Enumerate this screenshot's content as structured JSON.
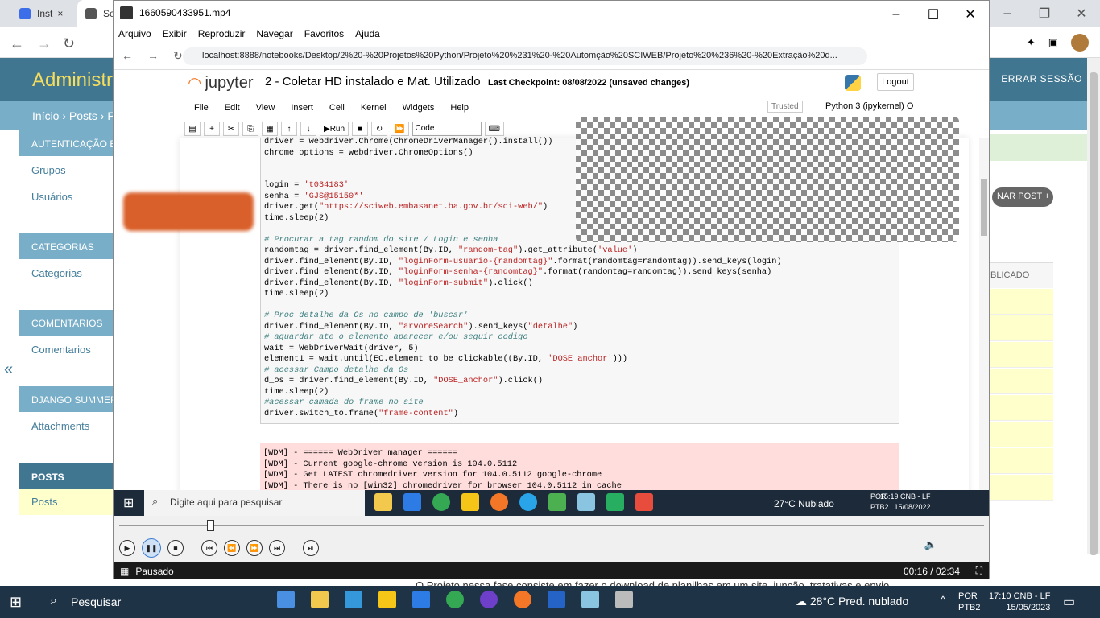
{
  "browser": {
    "tabs": [
      {
        "label": "Inst"
      },
      {
        "label": "Se"
      }
    ],
    "admin_title": "Administra",
    "logout": "ERRAR SESSÃO",
    "breadcrumb": "Início › Posts › P"
  },
  "sidebar": {
    "modules": [
      {
        "header": "AUTENTICAÇÃO E",
        "items": [
          "Grupos",
          "Usuários"
        ]
      },
      {
        "header": "CATEGORIAS",
        "items": [
          "Categorias"
        ]
      },
      {
        "header": "COMENTARIOS",
        "items": [
          "Comentarios"
        ]
      },
      {
        "header": "DJANGO SUMMER",
        "items": [
          "Attachments"
        ]
      },
      {
        "header": "POSTS",
        "items": [
          "Posts"
        ]
      }
    ],
    "collapse": "«"
  },
  "right_panel": {
    "add_button": "NAR POST",
    "column_header": "BLICADO"
  },
  "under_text": "O Projeto nessa fase consiste em fazer o download de planilhas em um site, junção, tratativas e envio",
  "player": {
    "title": "1660590433951.mp4",
    "menu": [
      "Arquivo",
      "Exibir",
      "Reproduzir",
      "Navegar",
      "Favoritos",
      "Ajuda"
    ],
    "status": "Pausado",
    "time": "00:16 / 02:34",
    "progress_fraction": 0.104
  },
  "inner_browser": {
    "url": "localhost:8888/notebooks/Desktop/2%20-%20Projetos%20Python/Projeto%20%231%20-%20Automção%20SCIWEB/Projeto%20%236%20-%20Extração%20d...",
    "notebook_title": "2 - Coletar HD instalado e Mat. Utilizado",
    "checkpoint": "Last Checkpoint: 08/08/2022  (unsaved changes)",
    "logout": "Logout",
    "jupyter": "jupyter",
    "menu": [
      "File",
      "Edit",
      "View",
      "Insert",
      "Cell",
      "Kernel",
      "Widgets",
      "Help"
    ],
    "trusted": "Trusted",
    "kernel": "Python 3 (ipykernel)  O",
    "run": "Run",
    "cell_type": "Code",
    "code_lines": [
      "driver = webdriver.Chrome(ChromeDriverManager().install())",
      "chrome_options = webdriver.ChromeOptions()",
      "",
      "",
      "login = 't034183'",
      "senha = 'GJS@15150*'",
      "driver.get(\"https://sciweb.embasanet.ba.gov.br/sci-web/\")",
      "time.sleep(2)",
      "",
      "# Procurar a tag random do site / Login e senha",
      "randomtag = driver.find_element(By.ID, \"random-tag\").get_attribute('value')",
      "driver.find_element(By.ID, \"loginForm-usuario-{randomtag}\".format(randomtag=randomtag)).send_keys(login)",
      "driver.find_element(By.ID, \"loginForm-senha-{randomtag}\".format(randomtag=randomtag)).send_keys(senha)",
      "driver.find_element(By.ID, \"loginForm-submit\").click()",
      "time.sleep(2)",
      "",
      "# Proc detalhe da Os no campo de 'buscar'",
      "driver.find_element(By.ID, \"arvoreSearch\").send_keys(\"detalhe\")",
      "# aguardar ate o elemento aparecer e/ou seguir codigo",
      "wait = WebDriverWait(driver, 5)",
      "element1 = wait.until(EC.element_to_be_clickable((By.ID, 'DOSE_anchor')))",
      "# acessar Campo detalhe da Os",
      "d_os = driver.find_element(By.ID, \"DOSE_anchor\").click()",
      "time.sleep(2)",
      "#acessar camada do frame no site",
      "driver.switch_to.frame(\"frame-content\")"
    ],
    "output_lines": [
      "[WDM] - ====== WebDriver manager ======",
      "[WDM] - Current google-chrome version is 104.0.5112",
      "[WDM] - Get LATEST chromedriver version for 104.0.5112 google-chrome",
      "[WDM] - There is no [win32] chromedriver for browser 104.0.5112 in cache"
    ],
    "taskbar_search": "Digite aqui para pesquisar",
    "weather": "27°C  Nublado",
    "lang": "POR\nPTB2",
    "clock": "15:19 CNB - LF\n15/08/2022"
  },
  "taskbar": {
    "search": "Pesquisar",
    "weather": "28°C  Pred. nublado",
    "lang1": "POR",
    "lang2": "PTB2",
    "time": "17:10 CNB - LF",
    "date": "15/05/2023"
  }
}
